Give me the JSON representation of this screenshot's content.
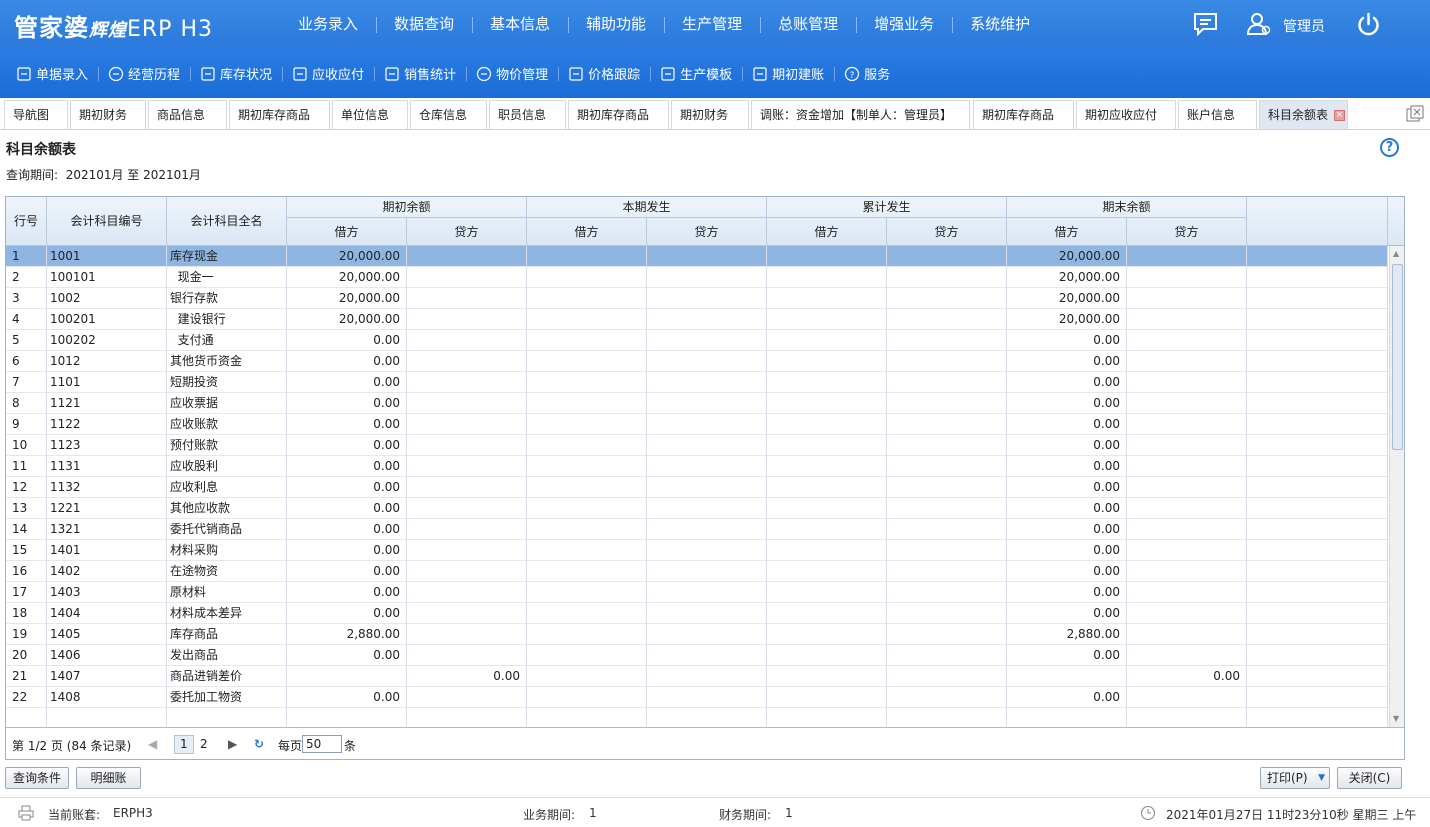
{
  "app": {
    "logo_main": "管家婆",
    "logo_sub": "辉煌",
    "logo_erp": "ERP H3"
  },
  "main_nav": [
    "业务录入",
    "数据查询",
    "基本信息",
    "辅助功能",
    "生产管理",
    "总账管理",
    "增强业务",
    "系统维护"
  ],
  "user": {
    "name": "管理员"
  },
  "toolbar": [
    "单据录入",
    "经营历程",
    "库存状况",
    "应收应付",
    "销售统计",
    "物价管理",
    "价格跟踪",
    "生产模板",
    "期初建账",
    "服务"
  ],
  "tabs": [
    "导航图",
    "期初财务",
    "商品信息",
    "期初库存商品",
    "单位信息",
    "仓库信息",
    "职员信息",
    "期初库存商品",
    "期初财务",
    "调账：资金增加【制单人：管理员】",
    "期初库存商品",
    "期初应收应付",
    "账户信息",
    "科目余额表"
  ],
  "page": {
    "title": "科目余额表",
    "period_label": "查询期间:",
    "period_value": "202101月 至 202101月"
  },
  "table": {
    "headers": {
      "row_no": "行号",
      "code": "会计科目编号",
      "name": "会计科目全名",
      "groups": [
        "期初余额",
        "本期发生",
        "累计发生",
        "期末余额"
      ],
      "debit": "借方",
      "credit": "贷方"
    },
    "rows": [
      {
        "no": "1",
        "code": "1001",
        "name": "库存现金",
        "ob_d": "20,000.00",
        "ob_c": "",
        "eb_d": "20,000.00",
        "eb_c": ""
      },
      {
        "no": "2",
        "code": "100101",
        "name": "  现金一",
        "ob_d": "20,000.00",
        "ob_c": "",
        "eb_d": "20,000.00",
        "eb_c": ""
      },
      {
        "no": "3",
        "code": "1002",
        "name": "银行存款",
        "ob_d": "20,000.00",
        "ob_c": "",
        "eb_d": "20,000.00",
        "eb_c": ""
      },
      {
        "no": "4",
        "code": "100201",
        "name": "  建设银行",
        "ob_d": "20,000.00",
        "ob_c": "",
        "eb_d": "20,000.00",
        "eb_c": ""
      },
      {
        "no": "5",
        "code": "100202",
        "name": "  支付通",
        "ob_d": "0.00",
        "ob_c": "",
        "eb_d": "0.00",
        "eb_c": ""
      },
      {
        "no": "6",
        "code": "1012",
        "name": "其他货币资金",
        "ob_d": "0.00",
        "ob_c": "",
        "eb_d": "0.00",
        "eb_c": ""
      },
      {
        "no": "7",
        "code": "1101",
        "name": "短期投资",
        "ob_d": "0.00",
        "ob_c": "",
        "eb_d": "0.00",
        "eb_c": ""
      },
      {
        "no": "8",
        "code": "1121",
        "name": "应收票据",
        "ob_d": "0.00",
        "ob_c": "",
        "eb_d": "0.00",
        "eb_c": ""
      },
      {
        "no": "9",
        "code": "1122",
        "name": "应收账款",
        "ob_d": "0.00",
        "ob_c": "",
        "eb_d": "0.00",
        "eb_c": ""
      },
      {
        "no": "10",
        "code": "1123",
        "name": "预付账款",
        "ob_d": "0.00",
        "ob_c": "",
        "eb_d": "0.00",
        "eb_c": ""
      },
      {
        "no": "11",
        "code": "1131",
        "name": "应收股利",
        "ob_d": "0.00",
        "ob_c": "",
        "eb_d": "0.00",
        "eb_c": ""
      },
      {
        "no": "12",
        "code": "1132",
        "name": "应收利息",
        "ob_d": "0.00",
        "ob_c": "",
        "eb_d": "0.00",
        "eb_c": ""
      },
      {
        "no": "13",
        "code": "1221",
        "name": "其他应收款",
        "ob_d": "0.00",
        "ob_c": "",
        "eb_d": "0.00",
        "eb_c": ""
      },
      {
        "no": "14",
        "code": "1321",
        "name": "委托代销商品",
        "ob_d": "0.00",
        "ob_c": "",
        "eb_d": "0.00",
        "eb_c": ""
      },
      {
        "no": "15",
        "code": "1401",
        "name": "材料采购",
        "ob_d": "0.00",
        "ob_c": "",
        "eb_d": "0.00",
        "eb_c": ""
      },
      {
        "no": "16",
        "code": "1402",
        "name": "在途物资",
        "ob_d": "0.00",
        "ob_c": "",
        "eb_d": "0.00",
        "eb_c": ""
      },
      {
        "no": "17",
        "code": "1403",
        "name": "原材料",
        "ob_d": "0.00",
        "ob_c": "",
        "eb_d": "0.00",
        "eb_c": ""
      },
      {
        "no": "18",
        "code": "1404",
        "name": "材料成本差异",
        "ob_d": "0.00",
        "ob_c": "",
        "eb_d": "0.00",
        "eb_c": ""
      },
      {
        "no": "19",
        "code": "1405",
        "name": "库存商品",
        "ob_d": "2,880.00",
        "ob_c": "",
        "eb_d": "2,880.00",
        "eb_c": ""
      },
      {
        "no": "20",
        "code": "1406",
        "name": "发出商品",
        "ob_d": "0.00",
        "ob_c": "",
        "eb_d": "0.00",
        "eb_c": ""
      },
      {
        "no": "21",
        "code": "1407",
        "name": "商品进销差价",
        "ob_d": "",
        "ob_c": "0.00",
        "eb_d": "",
        "eb_c": "0.00"
      },
      {
        "no": "22",
        "code": "1408",
        "name": "委托加工物资",
        "ob_d": "0.00",
        "ob_c": "",
        "eb_d": "0.00",
        "eb_c": ""
      }
    ]
  },
  "pager": {
    "summary": "第 1/2 页 (84 条记录)",
    "pages": [
      "1",
      "2"
    ],
    "per_page_label": "每页",
    "per_page_value": "50",
    "unit": "条"
  },
  "buttons": {
    "query": "查询条件",
    "detail": "明细账",
    "print": "打印(P)",
    "close": "关闭(C)"
  },
  "status": {
    "account_label": "当前账套:",
    "account_value": "ERPH3",
    "biz_period_label": "业务期间:",
    "biz_period_value": "1",
    "fin_period_label": "财务期间:",
    "fin_period_value": "1",
    "datetime": "2021年01月27日 11时23分10秒 星期三 上午"
  }
}
